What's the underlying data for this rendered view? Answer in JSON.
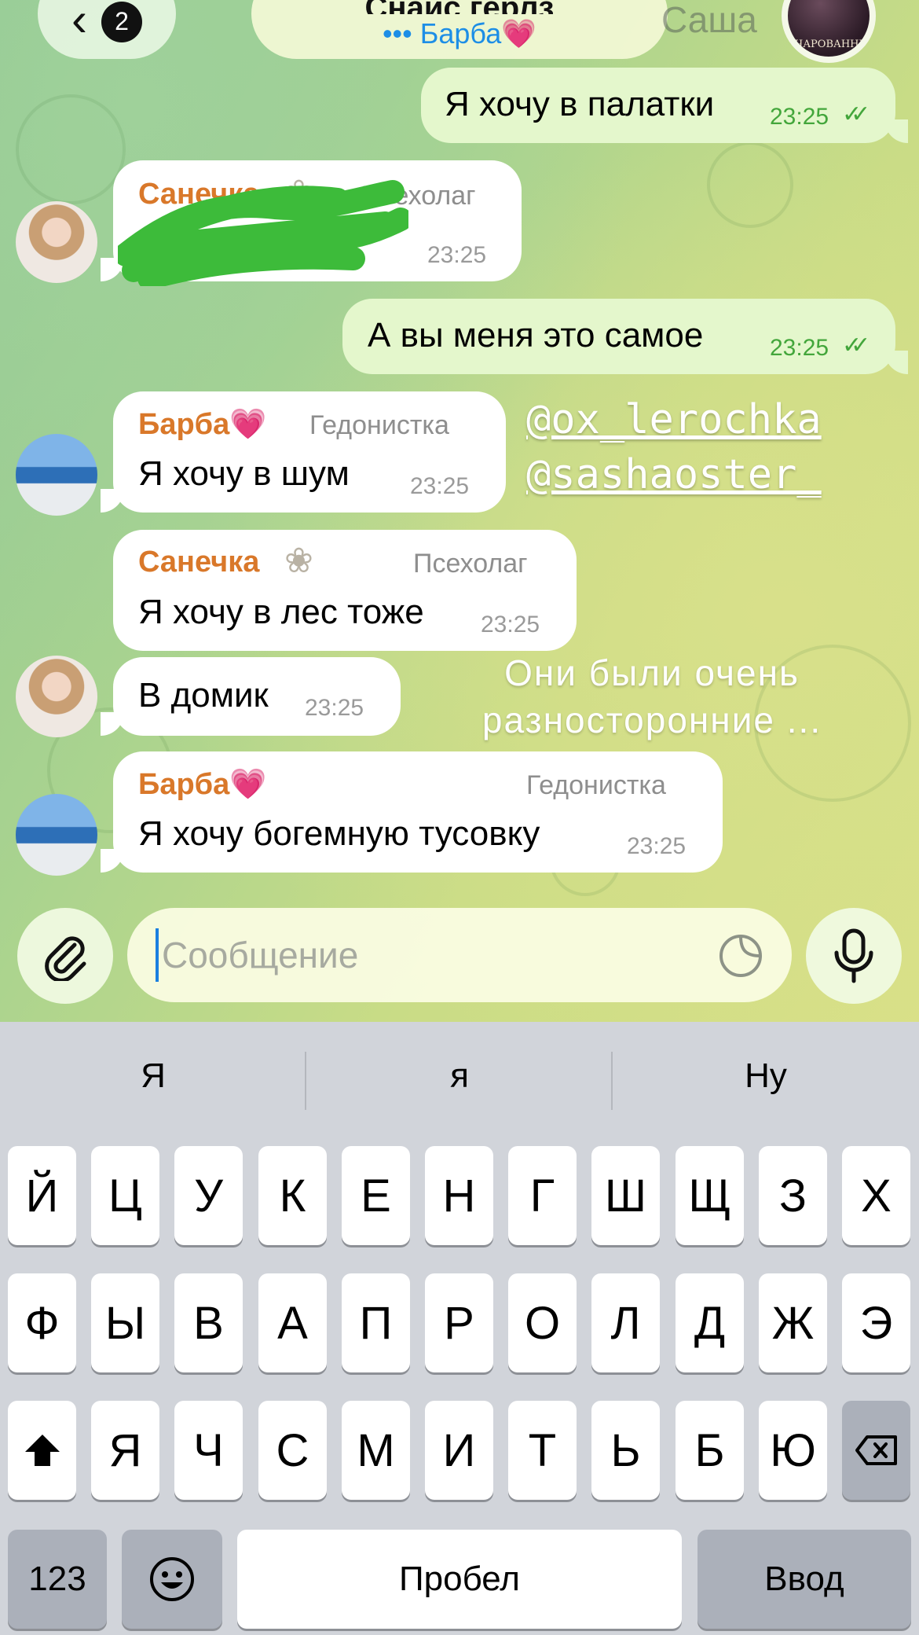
{
  "header": {
    "back_count": "2",
    "chat_title": "Снайс герлз",
    "typing_status": "••• Барба💗",
    "background_name": "Саша",
    "group_avatar_caption": "ЗАЧАРОВАННЫЕ"
  },
  "messages": [
    {
      "direction": "out",
      "text": "Я хочу в палатки",
      "time": "23:25",
      "status": "read"
    },
    {
      "direction": "in",
      "sender": "Санечка",
      "role": "Псехолаг",
      "text": "",
      "time": "23:25",
      "redacted": true
    },
    {
      "direction": "out",
      "text": "А вы меня это самое",
      "time": "23:25",
      "status": "read"
    },
    {
      "direction": "in",
      "sender": "Барба💗",
      "role": "Гедонистка",
      "text": "Я хочу в шум",
      "time": "23:25"
    },
    {
      "direction": "in",
      "sender": "Санечка",
      "role": "Псехолаг",
      "text": "Я хочу в лес тоже",
      "time": "23:25"
    },
    {
      "direction": "in",
      "text": "В домик",
      "time": "23:25"
    },
    {
      "direction": "in",
      "sender": "Барба💗",
      "role": "Гедонистка",
      "text": "Я хочу богемную тусовку",
      "time": "23:25"
    }
  ],
  "overlay": {
    "mention_1": "@ox_lerochka",
    "mention_2": "@sashaoster_",
    "note_line_1": "Они были очень",
    "note_line_2": "разносторонние ..."
  },
  "composer": {
    "placeholder": "Сообщение",
    "value": ""
  },
  "keyboard": {
    "suggestions": [
      "Я",
      "я",
      "Ну"
    ],
    "row1": [
      "Й",
      "Ц",
      "У",
      "К",
      "Е",
      "Н",
      "Г",
      "Ш",
      "Щ",
      "З",
      "Х"
    ],
    "row2": [
      "Ф",
      "Ы",
      "В",
      "А",
      "П",
      "Р",
      "О",
      "Л",
      "Д",
      "Ж",
      "Э"
    ],
    "row3": [
      "Я",
      "Ч",
      "С",
      "М",
      "И",
      "Т",
      "Ь",
      "Б",
      "Ю"
    ],
    "numbers_label": "123",
    "space_label": "Пробел",
    "return_label": "Ввод"
  },
  "colors": {
    "sender_name": "#d9782a",
    "read_check": "#43a63b",
    "typing": "#1d8ee6",
    "outgoing_bubble": "#e4f7cc",
    "scribble": "#3dbb3a"
  }
}
